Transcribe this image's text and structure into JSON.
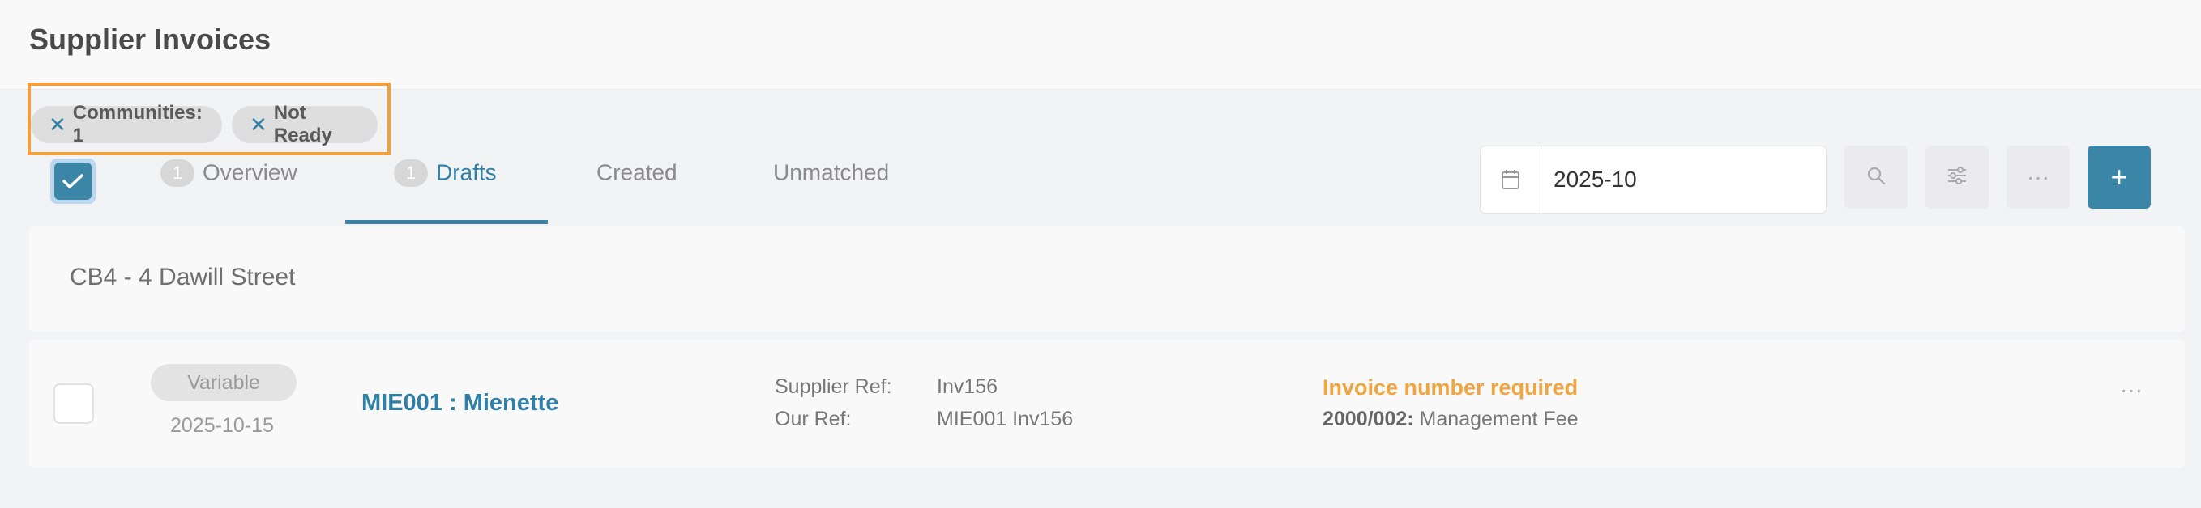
{
  "page": {
    "title": "Supplier Invoices"
  },
  "filters": [
    {
      "label": "Communities: 1",
      "remove_icon": "close-icon"
    },
    {
      "label": "Not Ready",
      "remove_icon": "close-icon"
    }
  ],
  "tabs": [
    {
      "badge": "1",
      "label": "Overview"
    },
    {
      "badge": "1",
      "label": "Drafts",
      "active": true
    },
    {
      "label": "Created"
    },
    {
      "label": "Unmatched"
    }
  ],
  "toolbar": {
    "period_value": "2025-10",
    "calendar_icon": "calendar-icon",
    "search_icon": "search-icon",
    "filter_icon": "sliders-icon",
    "more_label": "···",
    "add_label": "+"
  },
  "group": {
    "title": "CB4 - 4 Dawill Street"
  },
  "invoice": {
    "type": "Variable",
    "date": "2025-10-15",
    "supplier": "MIE001 : Mienette",
    "supplier_ref_label": "Supplier Ref:",
    "supplier_ref": "Inv156",
    "our_ref_label": "Our Ref:",
    "our_ref": "MIE001 Inv156",
    "warning": "Invoice number required",
    "account_code": "2000/002:",
    "account_name": " Management Fee",
    "more_label": "···"
  },
  "colors": {
    "accent": "#3b85a6",
    "warning": "#f0a640",
    "filter_highlight": "#f0a040"
  }
}
